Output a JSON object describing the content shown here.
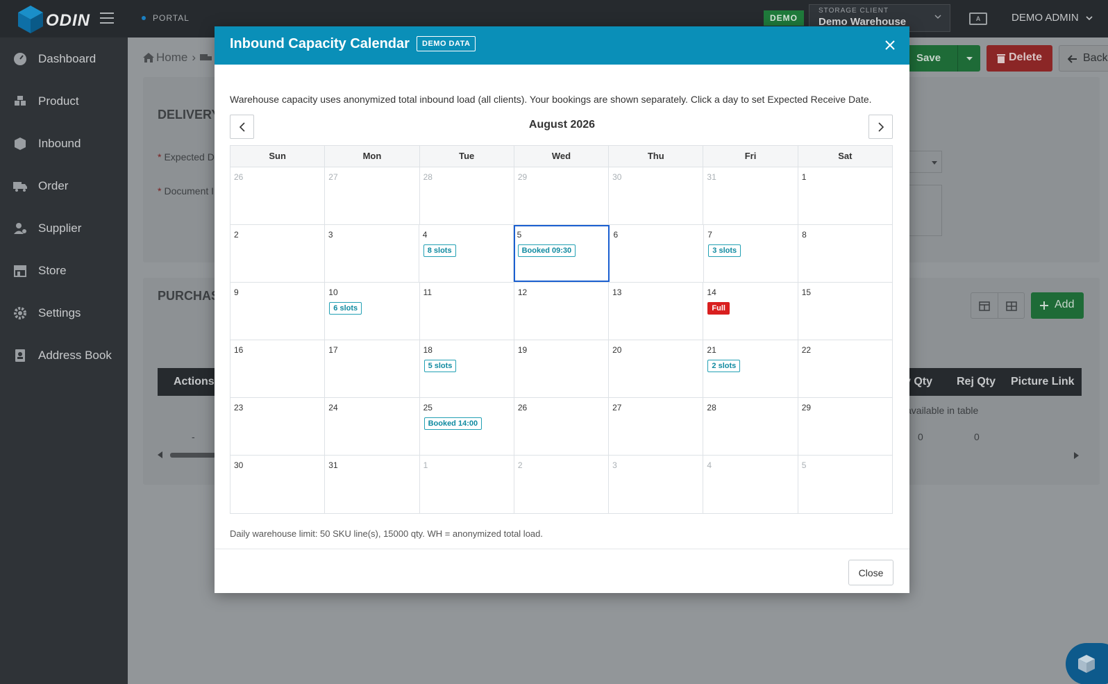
{
  "topbar": {
    "logo_text": "ODIN",
    "portal_label": "PORTAL",
    "demo_badge": "DEMO",
    "storage_client_label": "STORAGE CLIENT",
    "storage_client_value": "Demo Warehouse",
    "user_name": "DEMO ADMIN",
    "lang_icon_text": "A"
  },
  "sidebar": {
    "items": [
      {
        "label": "Dashboard",
        "icon": "dashboard-icon"
      },
      {
        "label": "Product",
        "icon": "product-icon"
      },
      {
        "label": "Inbound",
        "icon": "inbound-icon"
      },
      {
        "label": "Order",
        "icon": "truck-icon"
      },
      {
        "label": "Supplier",
        "icon": "supplier-icon"
      },
      {
        "label": "Store",
        "icon": "store-icon"
      },
      {
        "label": "Settings",
        "icon": "gear-icon"
      },
      {
        "label": "Address Book",
        "icon": "address-book-icon"
      }
    ]
  },
  "page": {
    "breadcrumb_home": "Home",
    "save_label": "Save",
    "delete_label": "Delete",
    "back_label": "Back",
    "delivery_title": "DELIVERY",
    "expected_label": "Expected D",
    "document_label": "Document I",
    "purchase_title": "PURCHAS",
    "add_label": "Add",
    "table_headers_left": [
      "Actions"
    ],
    "table_headers_right": [
      "v Qty",
      "Rej Qty",
      "Picture Link"
    ],
    "empty_text": "available in table",
    "row_dash": "-",
    "row_qty_1": "0",
    "row_qty_2": "0"
  },
  "modal": {
    "title": "Inbound Capacity Calendar",
    "badge": "DEMO DATA",
    "description": "Warehouse capacity uses anonymized total inbound load (all clients). Your bookings are shown separately. Click a day to set Expected Receive Date.",
    "month": "August 2026",
    "weekdays": [
      "Sun",
      "Mon",
      "Tue",
      "Wed",
      "Thu",
      "Fri",
      "Sat"
    ],
    "weeks": [
      [
        {
          "d": "26",
          "m": true
        },
        {
          "d": "27",
          "m": true
        },
        {
          "d": "28",
          "m": true
        },
        {
          "d": "29",
          "m": true
        },
        {
          "d": "30",
          "m": true
        },
        {
          "d": "31",
          "m": true
        },
        {
          "d": "1"
        }
      ],
      [
        {
          "d": "2"
        },
        {
          "d": "3"
        },
        {
          "d": "4",
          "tag": "8 slots"
        },
        {
          "d": "5",
          "tag": "Booked 09:30",
          "sel": true
        },
        {
          "d": "6"
        },
        {
          "d": "7",
          "tag": "3 slots"
        },
        {
          "d": "8"
        }
      ],
      [
        {
          "d": "9"
        },
        {
          "d": "10",
          "tag": "6 slots"
        },
        {
          "d": "11"
        },
        {
          "d": "12"
        },
        {
          "d": "13"
        },
        {
          "d": "14",
          "tag": "Full",
          "full": true
        },
        {
          "d": "15"
        }
      ],
      [
        {
          "d": "16"
        },
        {
          "d": "17"
        },
        {
          "d": "18",
          "tag": "5 slots"
        },
        {
          "d": "19"
        },
        {
          "d": "20"
        },
        {
          "d": "21",
          "tag": "2 slots"
        },
        {
          "d": "22"
        }
      ],
      [
        {
          "d": "23"
        },
        {
          "d": "24"
        },
        {
          "d": "25",
          "tag": "Booked 14:00"
        },
        {
          "d": "26"
        },
        {
          "d": "27"
        },
        {
          "d": "28"
        },
        {
          "d": "29"
        }
      ],
      [
        {
          "d": "30"
        },
        {
          "d": "31"
        },
        {
          "d": "1",
          "m": true
        },
        {
          "d": "2",
          "m": true
        },
        {
          "d": "3",
          "m": true
        },
        {
          "d": "4",
          "m": true
        },
        {
          "d": "5",
          "m": true
        }
      ]
    ],
    "footer_note": "Daily warehouse limit: 50 SKU line(s), 15000 qty. WH = anonymized total load.",
    "close_label": "Close"
  },
  "colors": {
    "header": "#0a8fb8",
    "topbar": "#262a2e",
    "sidebar": "#2f3337",
    "tag_info": "#22a0b4",
    "tag_full": "#d91f1f",
    "selected": "#1a5fd0"
  }
}
